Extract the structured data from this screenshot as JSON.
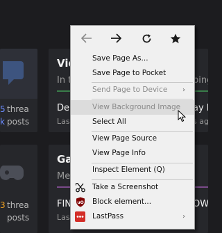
{
  "background": {
    "cards": [
      {
        "title": "Vid",
        "subtitle": "In t",
        "right_text": "ping",
        "row_text": "De",
        "row_sub": "Las",
        "right_row": "ay D",
        "right_row_sub": "s ag",
        "count1": "5",
        "count1_label": "threa",
        "count2": "k",
        "count2_label": "posts",
        "accent": "#6b8cff",
        "underline": "#3a7d4a"
      },
      {
        "title": "Ga",
        "subtitle": "Me",
        "right_text": "",
        "row_text": "FIN",
        "row_sub": "Las",
        "right_row": "OW",
        "right_row_sub": "s ag",
        "count1": "3",
        "count1_label": "threa",
        "count2": "",
        "count2_label": "posts",
        "accent": "#f0a020",
        "underline": "#7a4a8a"
      }
    ]
  },
  "menu": {
    "nav": {
      "back_icon": "arrow-left-icon",
      "forward_icon": "arrow-right-icon",
      "reload_icon": "reload-icon",
      "bookmark_icon": "star-icon"
    },
    "items": [
      {
        "label": "Save Page As...",
        "disabled": false
      },
      {
        "label": "Save Page to Pocket",
        "disabled": false
      },
      {
        "label": "Send Page to Device",
        "disabled": true,
        "submenu": true
      },
      {
        "label": "View Background Image",
        "disabled": true,
        "hover": true
      },
      {
        "label": "Select All",
        "disabled": false
      },
      {
        "label": "View Page Source",
        "disabled": false
      },
      {
        "label": "View Page Info",
        "disabled": false
      },
      {
        "label": "Inspect Element (Q)",
        "disabled": false
      },
      {
        "label": "Take a Screenshot",
        "disabled": false,
        "icon": "scissors-icon"
      },
      {
        "label": "Block element...",
        "disabled": false,
        "icon": "ublock-origin-icon",
        "icon_color": "#800000"
      },
      {
        "label": "LastPass",
        "disabled": false,
        "icon": "lastpass-icon",
        "icon_color": "#d32d27",
        "submenu": true
      }
    ],
    "submenu_arrow": "›"
  }
}
